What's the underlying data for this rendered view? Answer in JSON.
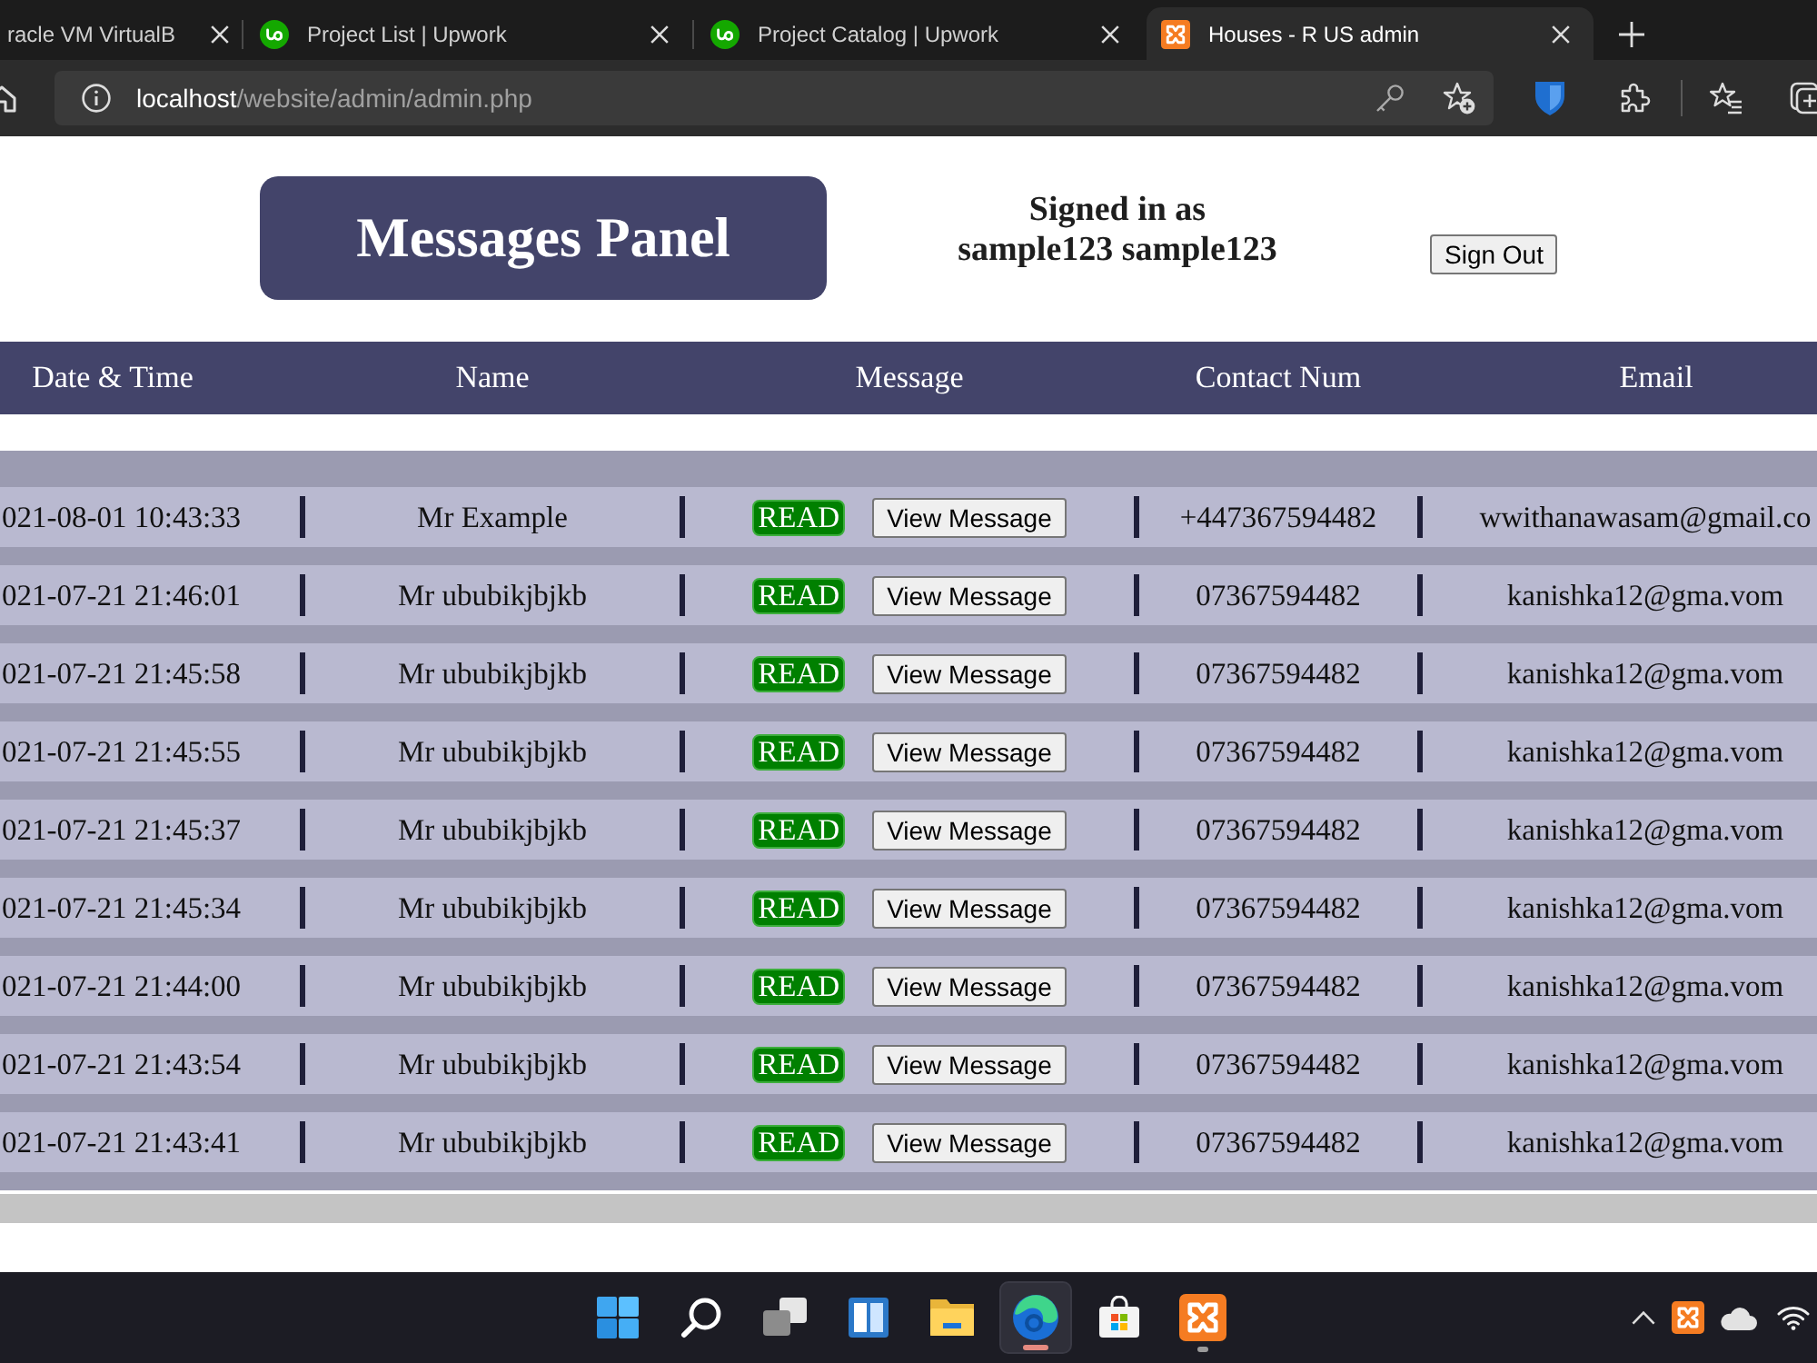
{
  "browser": {
    "tabs": [
      {
        "kind": "text-only",
        "title": "racle VM VirtualB",
        "selected": false
      },
      {
        "kind": "round-logo",
        "title": "Project List | Upwork",
        "selected": false
      },
      {
        "kind": "round-logo",
        "title": "Project Catalog | Upwork",
        "selected": false
      },
      {
        "kind": "tile-logo",
        "title": "Houses - R US admin",
        "selected": true
      }
    ],
    "address": {
      "host": "localhost",
      "path": "/website/admin/admin.php"
    }
  },
  "header": {
    "title": "Messages Panel",
    "signed_in_label": "Signed in as",
    "user": "sample123 sample123",
    "sign_out_button": "Sign Out"
  },
  "table": {
    "columns": [
      "Date & Time",
      "Name",
      "Message",
      "Contact Num",
      "Email"
    ],
    "rows": [
      {
        "date_time": "021-08-01 10:43:33",
        "name": "Mr Example",
        "status": "READ",
        "action": "View Message",
        "contact": "+447367594482",
        "email": "wwithanawasam@gmail.co"
      },
      {
        "date_time": "021-07-21 21:46:01",
        "name": "Mr ububikjbjkb",
        "status": "READ",
        "action": "View Message",
        "contact": "07367594482",
        "email": "kanishka12@gma.vom"
      },
      {
        "date_time": "021-07-21 21:45:58",
        "name": "Mr ububikjbjkb",
        "status": "READ",
        "action": "View Message",
        "contact": "07367594482",
        "email": "kanishka12@gma.vom"
      },
      {
        "date_time": "021-07-21 21:45:55",
        "name": "Mr ububikjbjkb",
        "status": "READ",
        "action": "View Message",
        "contact": "07367594482",
        "email": "kanishka12@gma.vom"
      },
      {
        "date_time": "021-07-21 21:45:37",
        "name": "Mr ububikjbjkb",
        "status": "READ",
        "action": "View Message",
        "contact": "07367594482",
        "email": "kanishka12@gma.vom"
      },
      {
        "date_time": "021-07-21 21:45:34",
        "name": "Mr ububikjbjkb",
        "status": "READ",
        "action": "View Message",
        "contact": "07367594482",
        "email": "kanishka12@gma.vom"
      },
      {
        "date_time": "021-07-21 21:44:00",
        "name": "Mr ububikjbjkb",
        "status": "READ",
        "action": "View Message",
        "contact": "07367594482",
        "email": "kanishka12@gma.vom"
      },
      {
        "date_time": "021-07-21 21:43:54",
        "name": "Mr ububikjbjkb",
        "status": "READ",
        "action": "View Message",
        "contact": "07367594482",
        "email": "kanishka12@gma.vom"
      },
      {
        "date_time": "021-07-21 21:43:41",
        "name": "Mr ububikjbjkb",
        "status": "READ",
        "action": "View Message",
        "contact": "07367594482",
        "email": "kanishka12@gma.vom"
      }
    ]
  },
  "taskbar": {
    "apps": [
      {
        "kind": "start",
        "selected": false,
        "running": false
      },
      {
        "kind": "search",
        "selected": false,
        "running": false
      },
      {
        "kind": "task-view",
        "selected": false,
        "running": false
      },
      {
        "kind": "widgets",
        "selected": false,
        "running": false
      },
      {
        "kind": "files",
        "selected": false,
        "running": false
      },
      {
        "kind": "browser",
        "selected": true,
        "running": true
      },
      {
        "kind": "store",
        "selected": false,
        "running": false
      },
      {
        "kind": "server",
        "selected": false,
        "running": true
      }
    ]
  }
}
